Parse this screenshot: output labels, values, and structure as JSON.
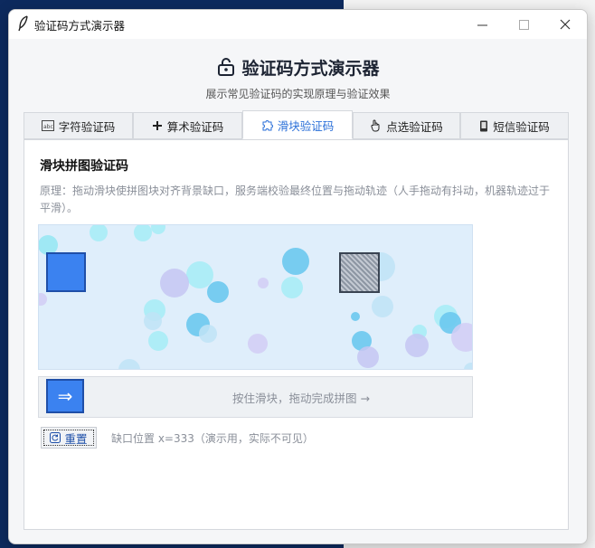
{
  "window": {
    "title": "验证码方式演示器"
  },
  "header": {
    "title": "验证码方式演示器",
    "subtitle": "展示常见验证码的实现原理与验证效果"
  },
  "tabs": [
    {
      "label": "字符验证码",
      "icon": "text-abc-icon",
      "active": false
    },
    {
      "label": "算术验证码",
      "icon": "plus-icon",
      "active": false
    },
    {
      "label": "滑块验证码",
      "icon": "puzzle-icon",
      "active": true
    },
    {
      "label": "点选验证码",
      "icon": "pointer-hand-icon",
      "active": false
    },
    {
      "label": "短信验证码",
      "icon": "phone-icon",
      "active": false
    }
  ],
  "panel": {
    "title": "滑块拼图验证码",
    "description": "原理：拖动滑块使拼图块对齐背景缺口，服务端校验最终位置与拖动轨迹（人手拖动有抖动，机器轨迹过于平滑）。",
    "slider_hint": "按住滑块，拖动完成拼图 →",
    "slider_arrow": "⇒",
    "reset_label": "重置",
    "gap_info": "缺口位置 x=333（演示用，实际不可见）"
  },
  "colors": {
    "accent": "#3b82f0",
    "puzzle_bg": "#dfeefb",
    "title_bar": "#ffffff"
  }
}
